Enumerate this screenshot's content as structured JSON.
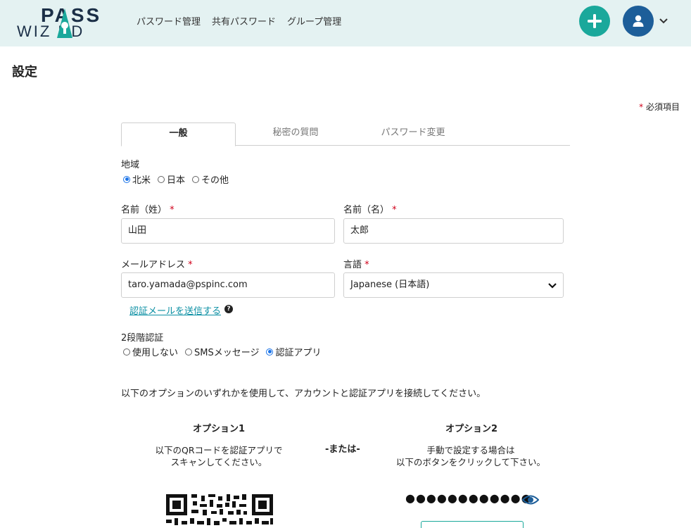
{
  "header": {
    "logo_line1": "PASS",
    "logo_line2": "WIZ  RD",
    "nav": [
      "パスワード管理",
      "共有パスワード",
      "グループ管理"
    ]
  },
  "page": {
    "title": "設定",
    "required_note_star": "*",
    "required_note": " 必須項目"
  },
  "tabs": [
    "一般",
    "秘密の質問",
    "パスワード変更"
  ],
  "region": {
    "label": "地域",
    "options": [
      "北米",
      "日本",
      "その他"
    ],
    "selected": "北米"
  },
  "form": {
    "last_name_label": "名前（姓）",
    "last_name_value": "山田",
    "first_name_label": "名前（名）",
    "first_name_value": "太郎",
    "email_label": "メールアドレス",
    "email_value": "taro.yamada@pspinc.com",
    "language_label": "言語",
    "language_value": "Japanese (日本語)",
    "required_mark": "*"
  },
  "verify_link": "認証メールを送信する",
  "help_icon": "?",
  "two_factor": {
    "label": "2段階認証",
    "options": [
      "使用しない",
      "SMSメッセージ",
      "認証アプリ"
    ],
    "selected": "認証アプリ"
  },
  "instructions": "以下のオプションのいずれかを使用して、アカウントと認証アプリを接続してください。",
  "option1": {
    "title": "オプション1",
    "line1": "以下のQRコードを認証アプリで",
    "line2": "スキャンしてください。"
  },
  "or_text": "-または-",
  "option2": {
    "title": "オプション2",
    "line1": "手動で設定する場合は",
    "line2": "以下のボタンをクリックして下さい。"
  },
  "secret_masked": "●●●●●●●●●●●●",
  "colors": {
    "header_bg": "#e4f2f2",
    "accent_teal": "#1aa89b",
    "avatar_blue": "#1d5e99",
    "required_red": "#d0021b",
    "link": "#0a8fa3",
    "radio_blue": "#1a73e8"
  },
  "icons": [
    "logo-key-icon",
    "plus-icon",
    "user-icon",
    "chevron-down-icon",
    "help-icon",
    "eye-icon",
    "qr-code"
  ]
}
